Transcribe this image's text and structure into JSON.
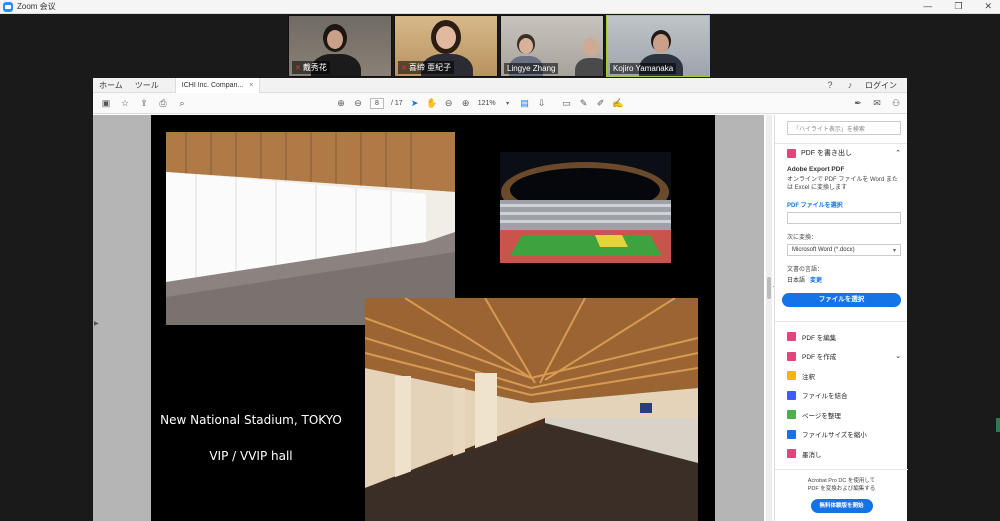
{
  "zoom": {
    "title": "Zoom 会议",
    "controls": [
      "—",
      "❐",
      "✕"
    ],
    "participants": [
      {
        "name": "戴秀花",
        "muted": true
      },
      {
        "name": "喜缔 亜紀子",
        "muted": true
      },
      {
        "name": "Lingye Zhang",
        "muted": false
      },
      {
        "name": "Kojiro Yamanaka",
        "muted": false
      }
    ]
  },
  "acrobat": {
    "menu": {
      "home": "ホーム",
      "tools": "ツール",
      "doc_tab": "ICHI Inc. Compan...",
      "close": "×",
      "login": "ログイン"
    },
    "toolbar": {
      "page_current": "8",
      "page_total": "/ 17",
      "zoom": "121%"
    },
    "slide": {
      "caption_line1": "New National Stadium, TOKYO",
      "caption_line2": "VIP / VVIP hall"
    },
    "panel": {
      "search_placeholder": "「ハイライト表示」を検索",
      "export_header": "PDF を書き出し",
      "export_title": "Adobe Export PDF",
      "export_desc": "オンラインで PDF ファイルを Word または Excel に変換します",
      "select_file_label": "PDF ファイルを選択",
      "convert_label": "次に変換：",
      "convert_value": "Microsoft Word (*.docx)",
      "doc_lang_label": "文書の言語：",
      "doc_lang_value": "日本語",
      "doc_lang_change": "変更",
      "select_button": "ファイルを選択",
      "tools": [
        {
          "label": "PDF を編集",
          "color": "#e0457b"
        },
        {
          "label": "PDF を作成",
          "color": "#e0457b",
          "caret": "⌄"
        },
        {
          "label": "注釈",
          "color": "#f6b700"
        },
        {
          "label": "ファイルを結合",
          "color": "#3d5afe"
        },
        {
          "label": "ページを整理",
          "color": "#4caf50"
        },
        {
          "label": "ファイルサイズを縮小",
          "color": "#1473e6"
        },
        {
          "label": "墨消し",
          "color": "#e0457b"
        }
      ],
      "promo_text_1": "Acrobat Pro DC を使用して",
      "promo_text_2": "PDF を変換および編集する",
      "promo_button": "無料体験版を開始"
    }
  }
}
